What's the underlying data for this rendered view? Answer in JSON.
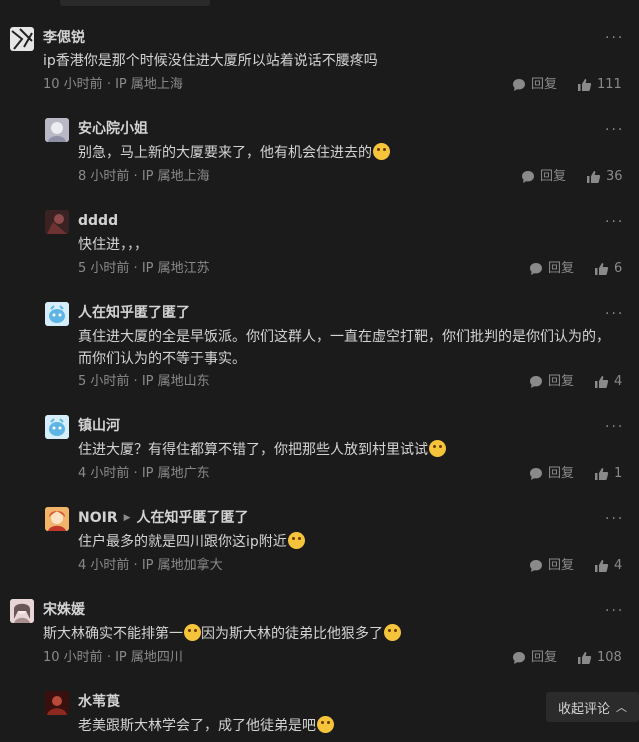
{
  "ui": {
    "reply_label": "回复",
    "more_glyph": "···",
    "collapse_label": "收起评论",
    "collapse_icon": "chevron-up-icon"
  },
  "comments": [
    {
      "name": "李偲锐",
      "text": "ip香港你是那个时候没住进大厦所以站着说话不腰疼吗",
      "time": "10 小时前",
      "location": "IP 属地上海",
      "likes": "111",
      "avatar_color": "#e6e6e6"
    },
    {
      "name": "安心院小姐",
      "text": "别急，马上新的大厦要来了，他有机会住进去的",
      "emoji_after": true,
      "time": "8 小时前",
      "location": "IP 属地上海",
      "likes": "36",
      "avatar_color": "#c9c9d2"
    },
    {
      "name": "dddd",
      "text": "快住进，，，",
      "time": "5 小时前",
      "location": "IP 属地江苏",
      "likes": "6",
      "avatar_color": "#5a2e2e"
    },
    {
      "name": "人在知乎匿了匿了",
      "text": "真住进大厦的全是早饭派。你们这群人，一直在虚空打靶，你们批判的是你们认为的，而你们认为的不等于事实。",
      "time": "5 小时前",
      "location": "IP 属地山东",
      "likes": "4",
      "avatar_color": "#7ec8f0"
    },
    {
      "name": "镇山河",
      "text": "住进大厦？有得住都算不错了，你把那些人放到村里试试",
      "emoji_after": true,
      "time": "4 小时前",
      "location": "IP 属地广东",
      "likes": "1",
      "avatar_color": "#7ec8f0"
    },
    {
      "name": "NOIR",
      "reply_to": "人在知乎匿了匿了",
      "text": "住户最多的就是四川跟你这ip附近",
      "emoji_after": true,
      "time": "4 小时前",
      "location": "IP 属地加拿大",
      "likes": "4",
      "avatar_color": "#e8923a"
    },
    {
      "name": "宋姝媛",
      "text_parts": [
        "斯大林确实不能排第一",
        "因为斯大林的徒弟比他狠多了"
      ],
      "time": "10 小时前",
      "location": "IP 属地四川",
      "likes": "108",
      "avatar_color": "#d9c4c4"
    },
    {
      "name": "水苇莨",
      "text": "老美跟斯大林学会了，成了他徒弟是吧",
      "emoji_after": true,
      "avatar_color": "#7a1f1f"
    }
  ]
}
